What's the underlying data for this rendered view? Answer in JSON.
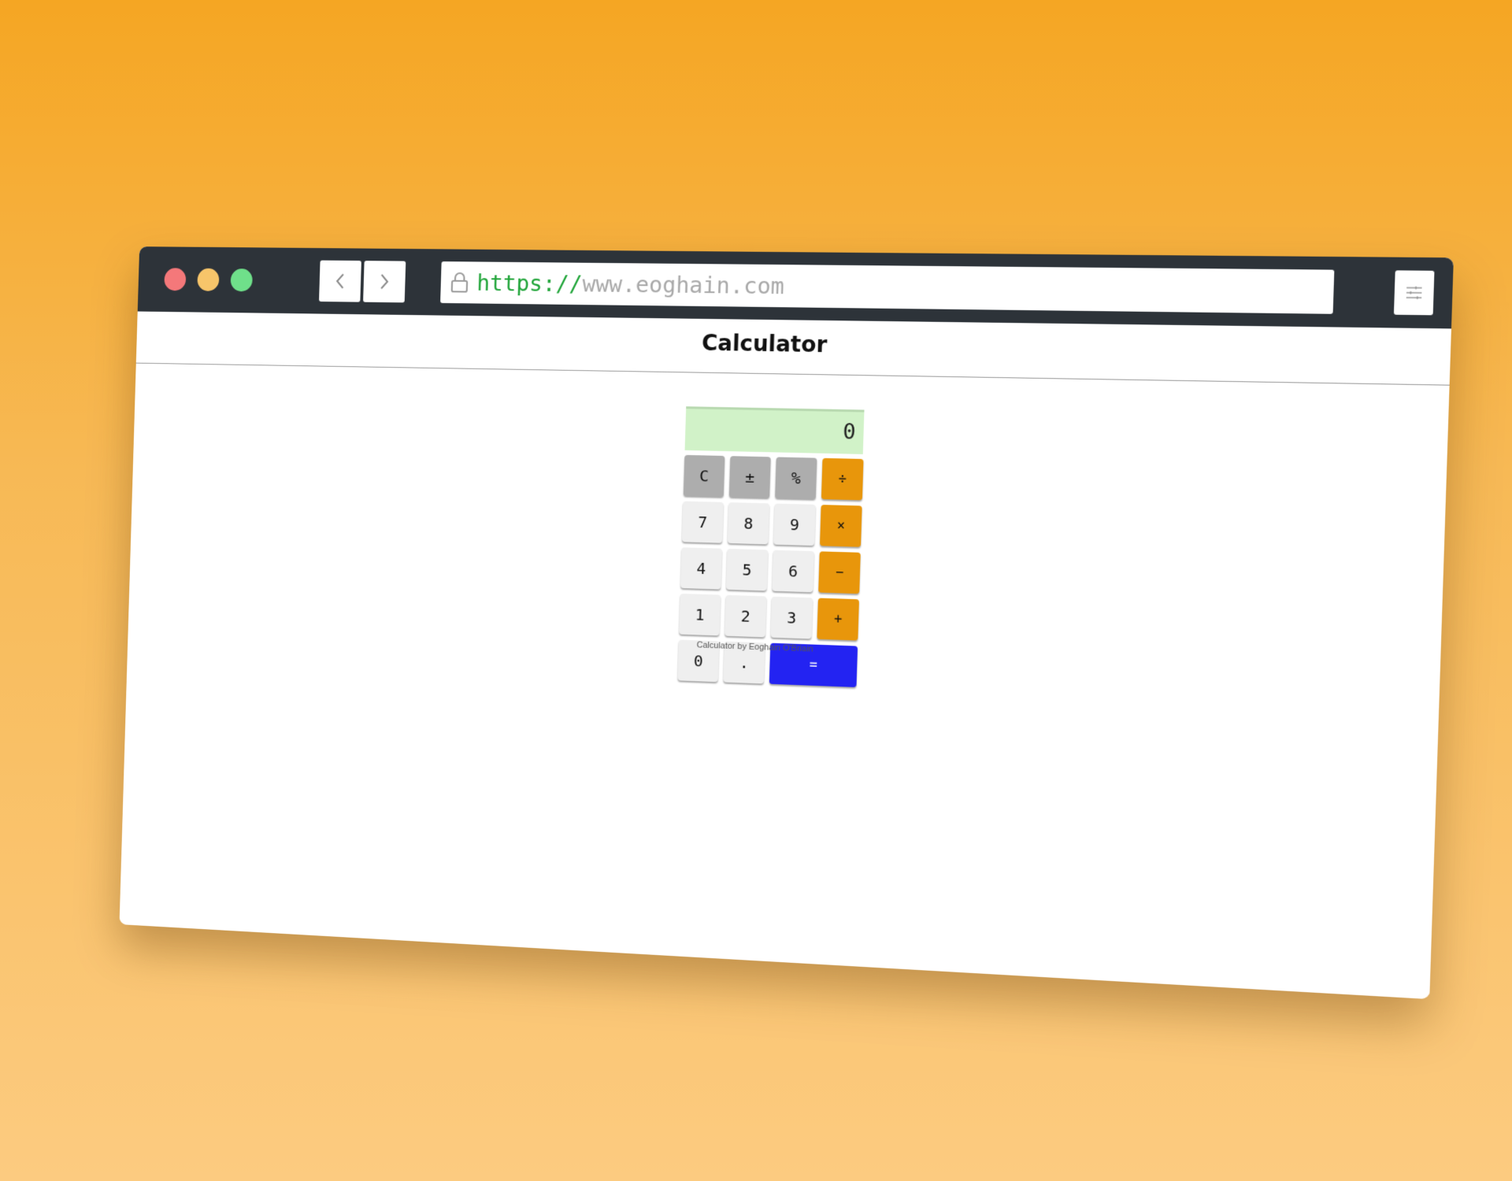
{
  "browser": {
    "url_scheme": "https://",
    "url_host": "www.eoghain.com",
    "icons": {
      "close": "close-dot",
      "minimize": "minimize-dot",
      "maximize": "maximize-dot",
      "back": "chevron-left-icon",
      "forward": "chevron-right-icon",
      "lock": "lock-icon",
      "menu": "sliders-icon"
    },
    "colors": {
      "chrome": "#2d3339",
      "close": "#f4787a",
      "minimize": "#f7c56a",
      "maximize": "#6fe08a",
      "scheme": "#21a53a"
    }
  },
  "page": {
    "title": "Calculator",
    "credit": "Calculator by Eoghain O'Briain"
  },
  "calculator": {
    "display": "0",
    "colors": {
      "display_bg": "#d1f2c8",
      "function_key": "#adadad",
      "number_key": "#efefef",
      "operator_key": "#e8960b",
      "equals_key": "#2323f2"
    },
    "keys": {
      "clear": "C",
      "sign": "±",
      "percent": "%",
      "divide": "÷",
      "seven": "7",
      "eight": "8",
      "nine": "9",
      "multiply": "×",
      "four": "4",
      "five": "5",
      "six": "6",
      "subtract": "−",
      "one": "1",
      "two": "2",
      "three": "3",
      "add": "+",
      "zero": "0",
      "decimal": ".",
      "equals": "="
    }
  }
}
